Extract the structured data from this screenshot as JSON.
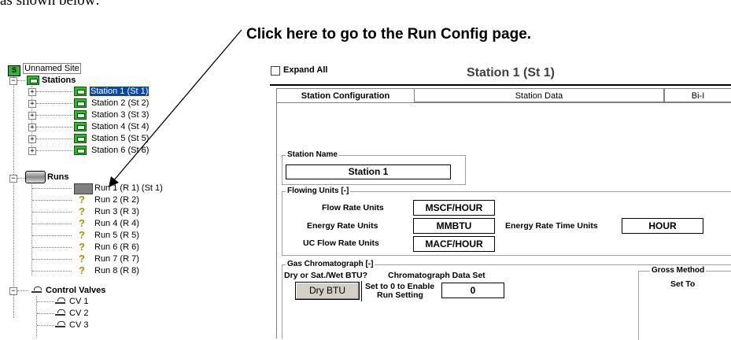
{
  "doc": {
    "top_text": "as shown below:",
    "callout": "Click here to go to the Run Config page."
  },
  "tree": {
    "root": "Unnamed Site",
    "stations_label": "Stations",
    "stations": [
      "Station 1 (St 1)",
      "Station 2 (St 2)",
      "Station 3 (St 3)",
      "Station 4 (St 4)",
      "Station 5 (St 5)",
      "Station 6 (St 6)"
    ],
    "runs_label": "Runs",
    "runs": [
      "Run 1 (R 1) (St 1)",
      "Run 2 (R 2)",
      "Run 3 (R 3)",
      "Run 4 (R 4)",
      "Run 5 (R 5)",
      "Run 6 (R 6)",
      "Run 7 (R 7)",
      "Run 8 (R 8)"
    ],
    "valves_label": "Control Valves",
    "valves": [
      "CV 1",
      "CV 2",
      "CV 3"
    ]
  },
  "panel": {
    "expand_all": "Expand All",
    "title": "Station 1 (St 1)",
    "tabs": [
      "Station Configuration",
      "Station Data",
      "Bi-I"
    ],
    "station_name_group": "Station Name",
    "station_name_value": "Station 1",
    "flowing_units_group": "Flowing Units [-]",
    "flow_rate_units_label": "Flow Rate Units",
    "flow_rate_units_value": "MSCF/HOUR",
    "energy_rate_units_label": "Energy Rate Units",
    "energy_rate_units_value": "MMBTU",
    "energy_rate_time_units_label": "Energy Rate Time Units",
    "energy_rate_time_units_value": "HOUR",
    "uc_flow_rate_units_label": "UC Flow Rate Units",
    "uc_flow_rate_units_value": "MACF/HOUR",
    "gas_chrom_group": "Gas Chromatograph [-]",
    "dry_wet_label": "Dry or Sat./Wet BTU?",
    "dry_btu_button": "Dry BTU",
    "chrom_data_set_label": "Chromatograph Data Set",
    "set_to_zero_label": "Set to 0 to Enable",
    "run_setting_label": "Run Setting",
    "chrom_data_set_value": "0",
    "gross_method_group": "Gross Method",
    "set_to_label": "Set To"
  },
  "colors": {
    "selection": "#0a46a8",
    "station_icon": "#2fb52f",
    "question_icon": "#b38b00"
  }
}
